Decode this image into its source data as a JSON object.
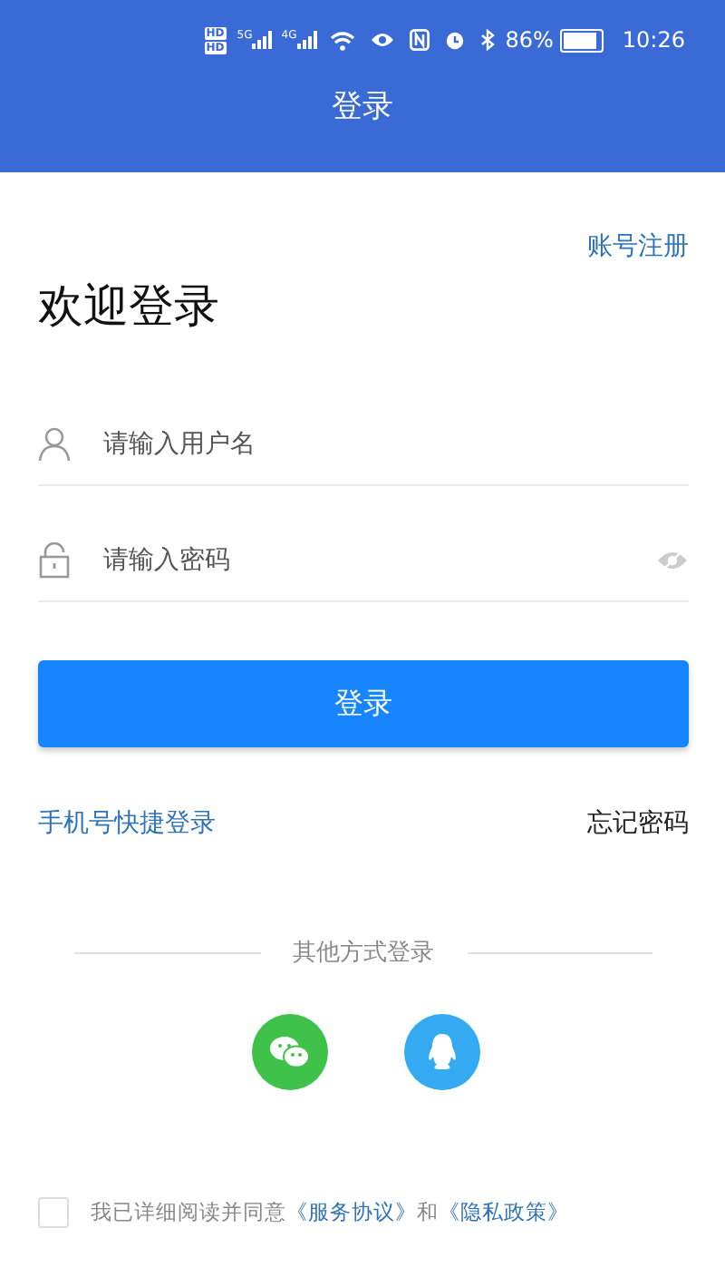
{
  "status_bar": {
    "sim_badges": [
      "HD",
      "HD"
    ],
    "networks": [
      "5G",
      "4G"
    ],
    "battery": "86%",
    "time": "10:26"
  },
  "header": {
    "title": "登录"
  },
  "register_link": "账号注册",
  "heading": "欢迎登录",
  "fields": [
    {
      "kind": "user",
      "placeholder": "请输入用户名"
    },
    {
      "kind": "password",
      "placeholder": "请输入密码"
    }
  ],
  "login_button": "登录",
  "links": {
    "left": "手机号快捷登录",
    "right": "忘记密码"
  },
  "other_methods": {
    "label": "其他方式登录",
    "options": [
      {
        "kind": "wechat",
        "color": "#3fc24a"
      },
      {
        "kind": "qq",
        "color": "#33aaf2"
      }
    ]
  },
  "agreement": {
    "checked": false,
    "parts": [
      {
        "kind": "text",
        "text": "我已详细阅读并同意"
      },
      {
        "kind": "link",
        "text": "《服务协议》"
      },
      {
        "kind": "text",
        "text": "和"
      },
      {
        "kind": "link",
        "text": "《隐私政策》"
      }
    ]
  }
}
